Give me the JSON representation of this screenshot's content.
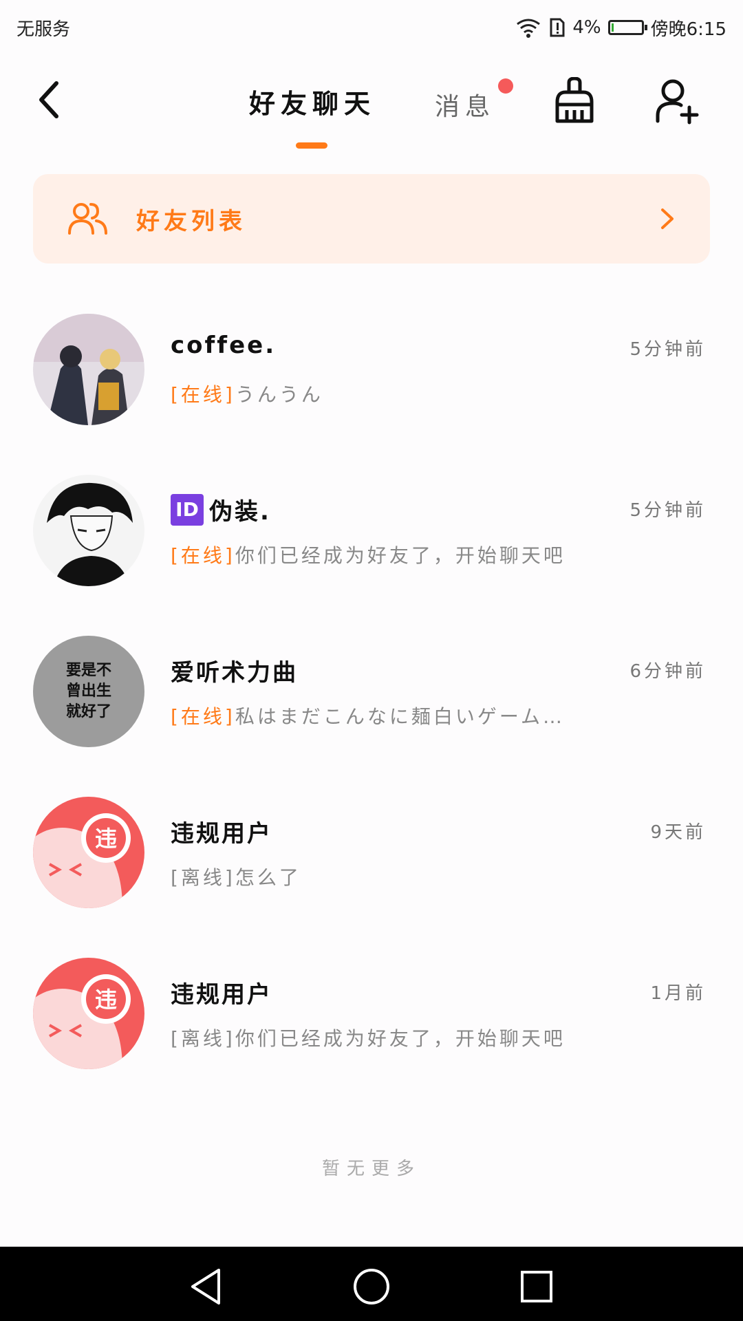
{
  "status_bar": {
    "carrier": "无服务",
    "battery": "4%",
    "time": "傍晚6:15"
  },
  "header": {
    "tab_chat": "好友聊天",
    "tab_messages": "消息"
  },
  "friend_list_card": {
    "label": "好友列表"
  },
  "chats": [
    {
      "name": "coffee.",
      "time": "5分钟前",
      "status": "[在线]",
      "preview": "うんうん",
      "online": true
    },
    {
      "name": "伪装.",
      "badge": "ID",
      "time": "5分钟前",
      "status": "[在线]",
      "preview": "你们已经成为好友了，开始聊天吧",
      "online": true
    },
    {
      "name": "爱听术力曲",
      "time": "6分钟前",
      "status": "[在线]",
      "preview": "私はまだこんなに麺白いゲーム…",
      "online": true,
      "avatar_text": [
        "要是不",
        "曾出生",
        "就好了"
      ]
    },
    {
      "name": "违规用户",
      "time": "9天前",
      "status": "[离线]",
      "preview": "怎么了",
      "online": false,
      "avatar_text": [
        "违"
      ]
    },
    {
      "name": "违规用户",
      "time": "1月前",
      "status": "[离线]",
      "preview": "你们已经成为好友了，开始聊天吧",
      "online": false,
      "avatar_text": [
        "违"
      ]
    }
  ],
  "footer": {
    "no_more": "暂无更多"
  },
  "colors": {
    "accent": "#ff7a18",
    "card_bg": "#fff0e8",
    "badge_dot": "#f55a5a"
  }
}
